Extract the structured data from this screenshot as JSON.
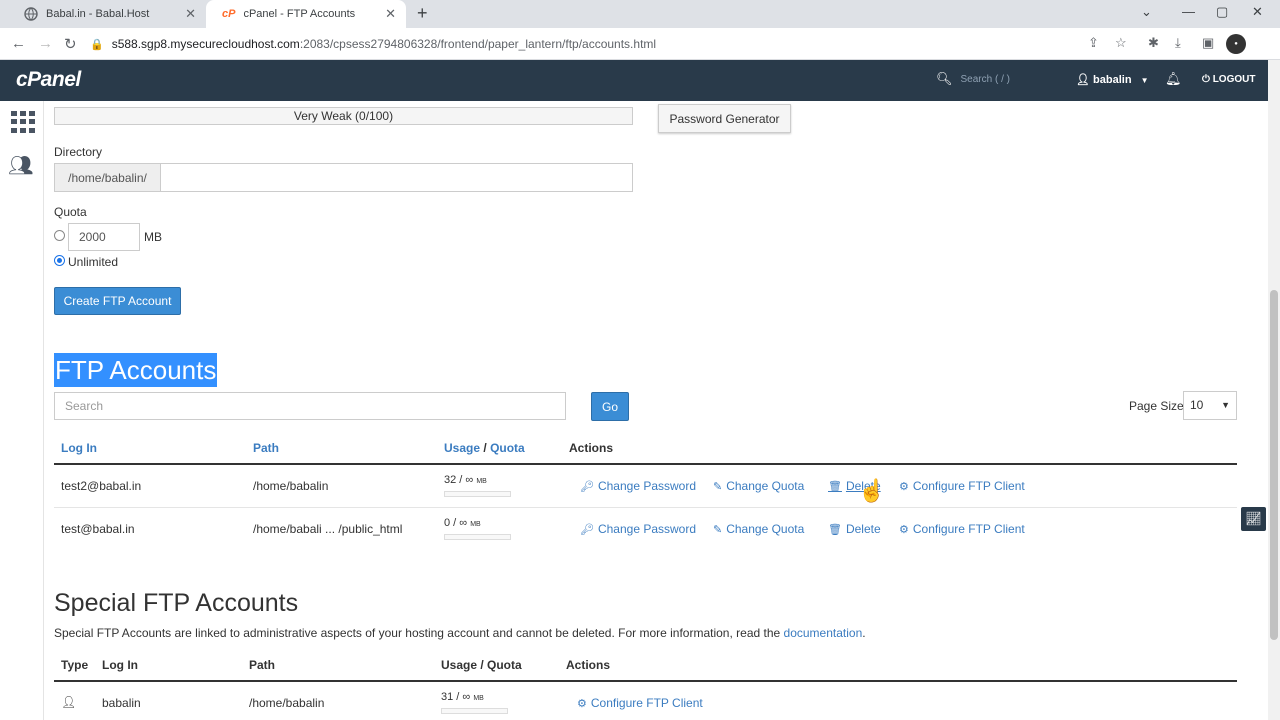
{
  "browser": {
    "tabs": [
      {
        "label": "Babal.in - Babal.Host",
        "close": "✕"
      },
      {
        "label": "cPanel - FTP Accounts",
        "close": "✕"
      }
    ],
    "new_tab": "+",
    "url_host": "s588.sgp8.mysecurecloudhost.com",
    "url_rest": ":2083/cpsess2794806328/frontend/paper_lantern/ftp/accounts.html"
  },
  "header": {
    "logo": "cPanel",
    "search_placeholder": "Search ( / )",
    "user": "babalin",
    "logout": "LOGOUT"
  },
  "form": {
    "strength": "Very Weak (0/100)",
    "password_generator": "Password Generator",
    "directory_label": "Directory",
    "directory_prefix": "/home/babalin/",
    "directory_value": "",
    "quota_label": "Quota",
    "quota_value": "2000",
    "quota_unit": "MB",
    "unlimited_label": "Unlimited",
    "create_button": "Create FTP Account"
  },
  "ftp_accounts": {
    "heading": "FTP Accounts",
    "search_placeholder": "Search",
    "go": "Go",
    "page_size_label": "Page Size",
    "page_size_value": "10",
    "columns": {
      "login": "Log In",
      "path": "Path",
      "usage": "Usage",
      "slash": "/",
      "quota": "Quota",
      "actions": "Actions"
    },
    "rows": [
      {
        "login": "test2@babal.in",
        "path": "/home/babalin",
        "usage": "32 / ∞",
        "unit": "MB"
      },
      {
        "login": "test@babal.in",
        "path": "/home/babali ... /public_html",
        "usage": "0 / ∞",
        "unit": "MB"
      }
    ],
    "actions": {
      "change_password": "Change Password",
      "change_quota": "Change Quota",
      "delete": "Delete",
      "configure": "Configure FTP Client"
    }
  },
  "special": {
    "heading": "Special FTP Accounts",
    "description": "Special FTP Accounts are linked to administrative aspects of your hosting account and cannot be deleted. For more information, read the ",
    "doc_link": "documentation",
    "period": ".",
    "columns": {
      "type": "Type",
      "login": "Log In",
      "path": "Path",
      "usage": "Usage / Quota",
      "actions": "Actions"
    },
    "rows": [
      {
        "login": "babalin",
        "path": "/home/babalin",
        "usage": "31 / ∞",
        "unit": "MB",
        "action": "Configure FTP Client"
      }
    ]
  }
}
